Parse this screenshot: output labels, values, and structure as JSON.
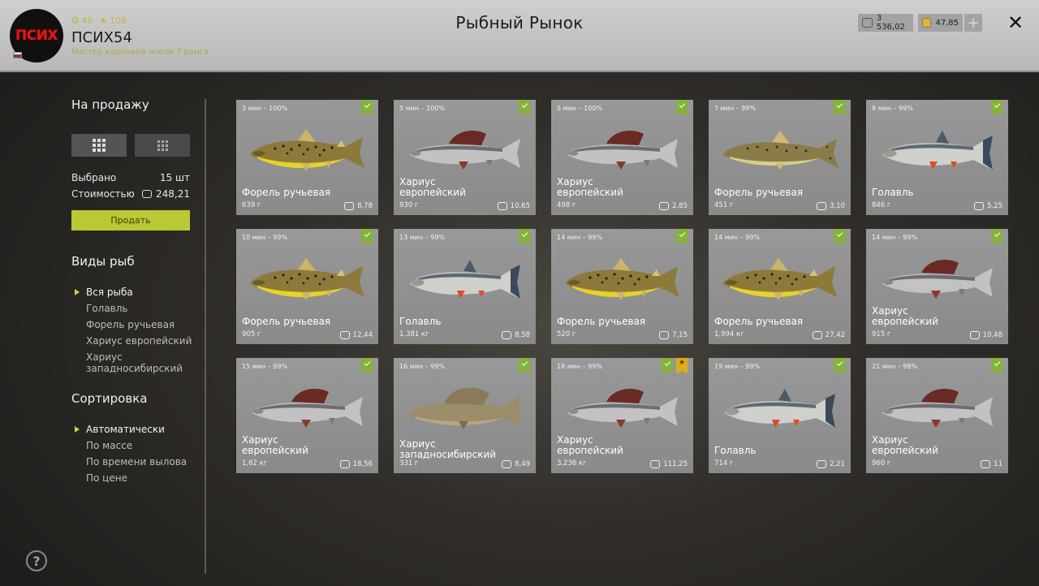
{
  "header": {
    "avatar_text": "ПСИХ",
    "coins_stat": "48",
    "stars_stat": "108",
    "player_name": "ПСИХ54",
    "player_rank": "Мастер карповой ловли 7 ранга",
    "title": "Рыбный Рынок",
    "silver": "3 536,02",
    "gold": "47,85",
    "plus": "+",
    "close": "✕"
  },
  "sidebar": {
    "for_sale_title": "На продажу",
    "selected_label": "Выбрано",
    "selected_value": "15 шт",
    "cost_label": "Стоимостью",
    "cost_value": "248,21",
    "sell_button": "Продать",
    "species_title": "Виды рыб",
    "species": [
      "Вся рыба",
      "Голавль",
      "Форель ручьевая",
      "Хариус европейский",
      "Хариус западносибирский"
    ],
    "sort_title": "Сортировка",
    "sort_options": [
      "Автоматически",
      "По массе",
      "По времени вылова",
      "По цене"
    ],
    "help": "?"
  },
  "colors": {
    "accent": "#b9c834",
    "check": "#84b33a",
    "star": "#dcae1c",
    "card": "#909090"
  },
  "fish": [
    {
      "time": "3 мин – 100%",
      "name": "Форель ручьевая",
      "weight": "639 г",
      "price": "8,78",
      "kind": "trout"
    },
    {
      "time": "5 мин – 100%",
      "name": "Хариус европейский",
      "weight": "930 г",
      "price": "10,65",
      "kind": "grayling"
    },
    {
      "time": "5 мин – 100%",
      "name": "Хариус европейский",
      "weight": "498 г",
      "price": "2,85",
      "kind": "grayling"
    },
    {
      "time": "7 мин – 99%",
      "name": "Форель ручьевая",
      "weight": "451 г",
      "price": "3,10",
      "kind": "trout2"
    },
    {
      "time": "8 мин – 99%",
      "name": "Голавль",
      "weight": "846 г",
      "price": "5,25",
      "kind": "chub"
    },
    {
      "time": "10 мин – 99%",
      "name": "Форель ручьевая",
      "weight": "905 г",
      "price": "12,44",
      "kind": "trout"
    },
    {
      "time": "13 мин – 99%",
      "name": "Голавль",
      "weight": "1,381 кг",
      "price": "8,58",
      "kind": "chub"
    },
    {
      "time": "14 мин – 99%",
      "name": "Форель ручьевая",
      "weight": "520 г",
      "price": "7,15",
      "kind": "trout"
    },
    {
      "time": "14 мин – 99%",
      "name": "Форель ручьевая",
      "weight": "1,994 кг",
      "price": "27,42",
      "kind": "trout"
    },
    {
      "time": "14 мин – 99%",
      "name": "Хариус европейский",
      "weight": "915 г",
      "price": "10,48",
      "kind": "grayling"
    },
    {
      "time": "15 мин – 99%",
      "name": "Хариус европейский",
      "weight": "1,62 кг",
      "price": "18,56",
      "kind": "grayling"
    },
    {
      "time": "16 мин – 99%",
      "name": "Хариус западносибирский",
      "weight": "331 г",
      "price": "8,49",
      "kind": "wgrayling"
    },
    {
      "time": "18 мин – 99%",
      "name": "Хариус европейский",
      "weight": "3,236 кг",
      "price": "111,25",
      "kind": "grayling",
      "trophy": true
    },
    {
      "time": "19 мин – 99%",
      "name": "Голавль",
      "weight": "714 г",
      "price": "2,21",
      "kind": "chub"
    },
    {
      "time": "21 мин – 98%",
      "name": "Хариус европейский",
      "weight": "960 г",
      "price": "11",
      "kind": "grayling"
    }
  ]
}
